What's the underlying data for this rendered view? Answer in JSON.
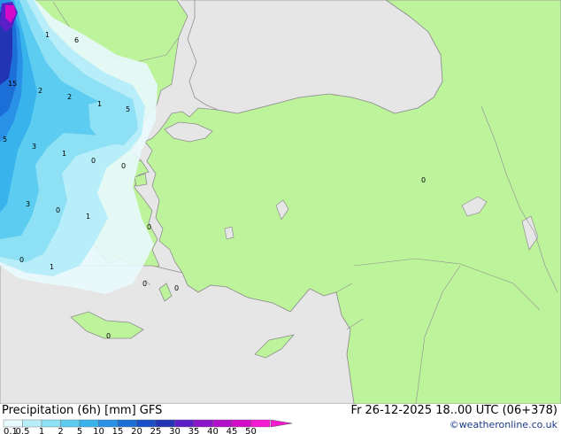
{
  "header": {
    "title": "Precipitation (6h) [mm] GFS",
    "date": "Fr 26-12-2025 18..00 UTC (06+378)",
    "credit": "©weatheronline.co.uk"
  },
  "legend": {
    "labels": [
      "0.1",
      "0.5",
      "1",
      "2",
      "5",
      "10",
      "15",
      "20",
      "25",
      "30",
      "35",
      "40",
      "45",
      "50"
    ],
    "colors": [
      "#e8fafd",
      "#b8eef9",
      "#8ee0f4",
      "#5ccdf0",
      "#38b3ec",
      "#2a92e6",
      "#1d6fd8",
      "#1a4fc8",
      "#2233b3",
      "#5a1fc6",
      "#8a16c9",
      "#b10fc9",
      "#d40bc8",
      "#f51ad1"
    ]
  },
  "map": {
    "colors": {
      "sea": "#e6e6e6",
      "land": "#bdf39b",
      "coast": "#8f8f8f"
    },
    "value_labels": [
      "1",
      "6",
      "15",
      "2",
      "2",
      "1",
      "5",
      "5",
      "3",
      "1",
      "0",
      "0",
      "3",
      "0",
      "1",
      "0",
      "0",
      "1",
      "0",
      "0",
      "0",
      "0"
    ]
  }
}
